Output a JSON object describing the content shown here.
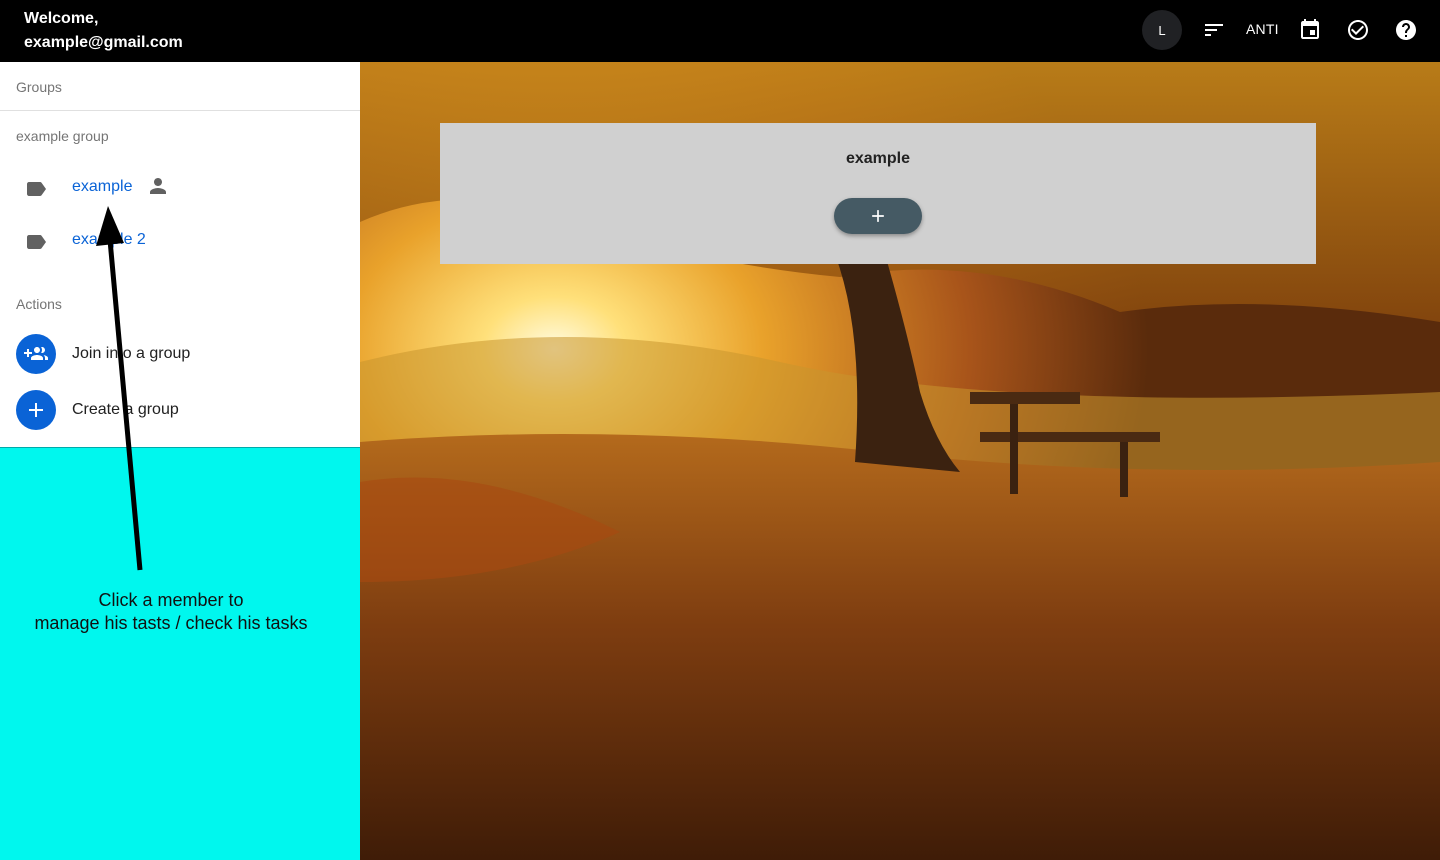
{
  "header": {
    "welcome_line": "Welcome,",
    "email": "example@gmail.com",
    "avatar_initial": "L",
    "filter_label": "ANTI",
    "icons": [
      "sort-icon",
      "calendar-icon",
      "check-circle-icon",
      "help-icon"
    ]
  },
  "sidebar": {
    "groups_header": "Groups",
    "group_name": "example group",
    "members": [
      {
        "name": "example",
        "has_person_icon": true
      },
      {
        "name": "example 2",
        "has_person_icon": false
      }
    ],
    "actions_header": "Actions",
    "actions": [
      {
        "label": "Join into a group",
        "icon": "group-add-icon"
      },
      {
        "label": "Create a group",
        "icon": "plus-icon"
      }
    ]
  },
  "tutorial": {
    "line1": "Click a member to",
    "line2": "manage his tasts / check his tasks"
  },
  "main": {
    "card_title": "example",
    "add_button_label": "+"
  },
  "colors": {
    "appbar": "#000000",
    "link": "#0a63d6",
    "action_circle": "#0a63d6",
    "tutorial_bg": "#00f7ee",
    "card_bg": "#d0d0d0",
    "add_button": "#455a64"
  }
}
